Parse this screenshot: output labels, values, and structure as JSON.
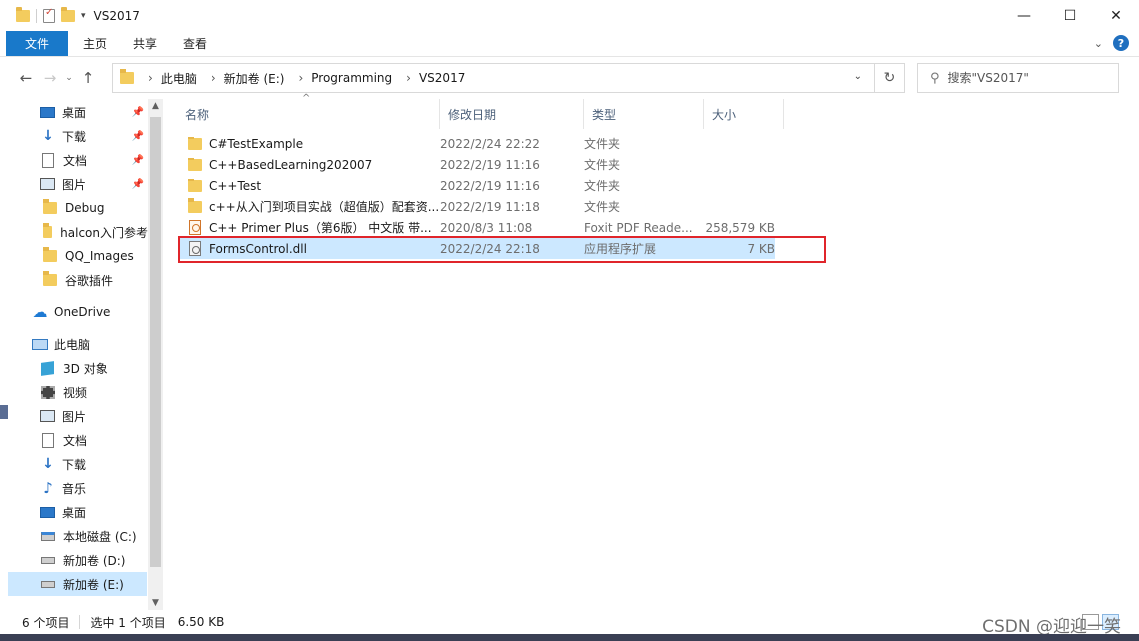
{
  "window": {
    "title": "VS2017",
    "minimize_icon": "minimize-icon",
    "maximize_icon": "maximize-icon",
    "close_icon": "close-icon"
  },
  "ribbon": {
    "tabs": [
      {
        "label": "文件",
        "active": true
      },
      {
        "label": "主页"
      },
      {
        "label": "共享"
      },
      {
        "label": "查看"
      }
    ],
    "accent_color": "#1979ca"
  },
  "address": {
    "crumbs": [
      "此电脑",
      "新加卷 (E:)",
      "Programming",
      "VS2017"
    ]
  },
  "search": {
    "placeholder": "搜索\"VS2017\""
  },
  "sidebar": {
    "quick_access": [
      {
        "label": "桌面",
        "icon": "desktop-icon",
        "pinned": true
      },
      {
        "label": "下载",
        "icon": "download-icon",
        "pinned": true
      },
      {
        "label": "文档",
        "icon": "document-icon",
        "pinned": true
      },
      {
        "label": "图片",
        "icon": "picture-icon",
        "pinned": true
      },
      {
        "label": "Debug",
        "icon": "folder-icon"
      },
      {
        "label": "halcon入门参考",
        "icon": "folder-icon"
      },
      {
        "label": "QQ_Images",
        "icon": "folder-icon"
      },
      {
        "label": "谷歌插件",
        "icon": "folder-icon"
      }
    ],
    "onedrive": "OneDrive",
    "this_pc": "此电脑",
    "pc_items": [
      {
        "label": "3D 对象",
        "icon": "3d-objects-icon"
      },
      {
        "label": "视频",
        "icon": "video-icon"
      },
      {
        "label": "图片",
        "icon": "picture-icon"
      },
      {
        "label": "文档",
        "icon": "document-icon"
      },
      {
        "label": "下载",
        "icon": "download-icon"
      },
      {
        "label": "音乐",
        "icon": "music-icon"
      },
      {
        "label": "桌面",
        "icon": "desktop-icon"
      },
      {
        "label": "本地磁盘 (C:)",
        "icon": "drive-icon"
      },
      {
        "label": "新加卷 (D:)",
        "icon": "drive-icon"
      },
      {
        "label": "新加卷 (E:)",
        "icon": "drive-icon",
        "selected": true
      }
    ]
  },
  "filelist": {
    "columns": {
      "name": "名称",
      "date": "修改日期",
      "type": "类型",
      "size": "大小"
    },
    "rows": [
      {
        "name": "C#TestExample",
        "date": "2022/2/24 22:22",
        "type": "文件夹",
        "size": "",
        "icon": "folder-icon"
      },
      {
        "name": "C++BasedLearning202007",
        "date": "2022/2/19 11:16",
        "type": "文件夹",
        "size": "",
        "icon": "folder-icon"
      },
      {
        "name": "C++Test",
        "date": "2022/2/19 11:16",
        "type": "文件夹",
        "size": "",
        "icon": "folder-icon"
      },
      {
        "name": "c++从入门到项目实战（超值版）配套资...",
        "date": "2022/2/19 11:18",
        "type": "文件夹",
        "size": "",
        "icon": "folder-icon"
      },
      {
        "name": "C++ Primer Plus（第6版） 中文版 带...",
        "date": "2020/8/3 11:08",
        "type": "Foxit PDF Reade...",
        "size": "258,579 KB",
        "icon": "pdf-icon"
      },
      {
        "name": "FormsControl.dll",
        "date": "2022/2/24 22:18",
        "type": "应用程序扩展",
        "size": "7 KB",
        "icon": "dll-icon",
        "selected": true
      }
    ],
    "highlight_color": "#e0252b"
  },
  "status": {
    "item_count": "6 个项目",
    "selection": "选中 1 个项目",
    "selection_size": "6.50 KB"
  },
  "watermark": "CSDN @迎迎一笑"
}
